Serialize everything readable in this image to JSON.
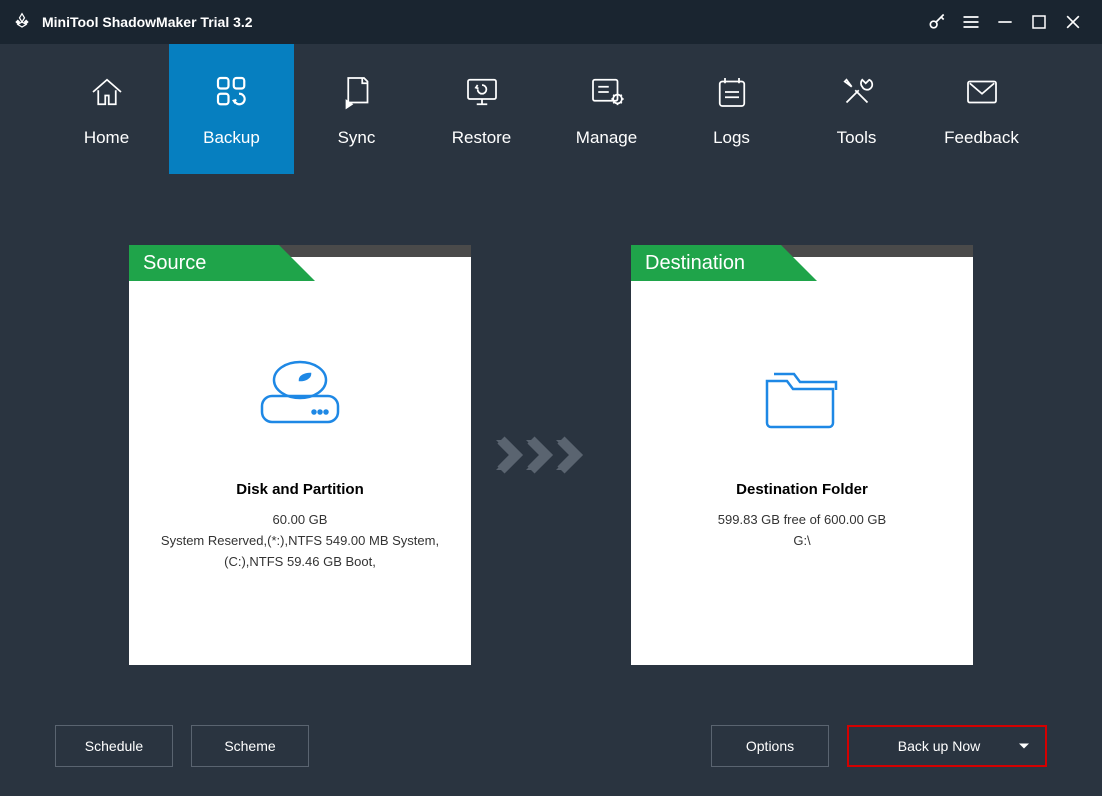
{
  "app": {
    "title": "MiniTool ShadowMaker Trial 3.2"
  },
  "nav": {
    "items": [
      {
        "label": "Home"
      },
      {
        "label": "Backup"
      },
      {
        "label": "Sync"
      },
      {
        "label": "Restore"
      },
      {
        "label": "Manage"
      },
      {
        "label": "Logs"
      },
      {
        "label": "Tools"
      },
      {
        "label": "Feedback"
      }
    ]
  },
  "source": {
    "header": "Source",
    "title": "Disk and Partition",
    "size": "60.00 GB",
    "detail1": "System Reserved,(*:),NTFS 549.00 MB System,",
    "detail2": "(C:),NTFS 59.46 GB Boot,"
  },
  "destination": {
    "header": "Destination",
    "title": "Destination Folder",
    "free": "599.83 GB free of 600.00 GB",
    "path": "G:\\"
  },
  "footer": {
    "schedule": "Schedule",
    "scheme": "Scheme",
    "options": "Options",
    "backup_now": "Back up Now"
  }
}
